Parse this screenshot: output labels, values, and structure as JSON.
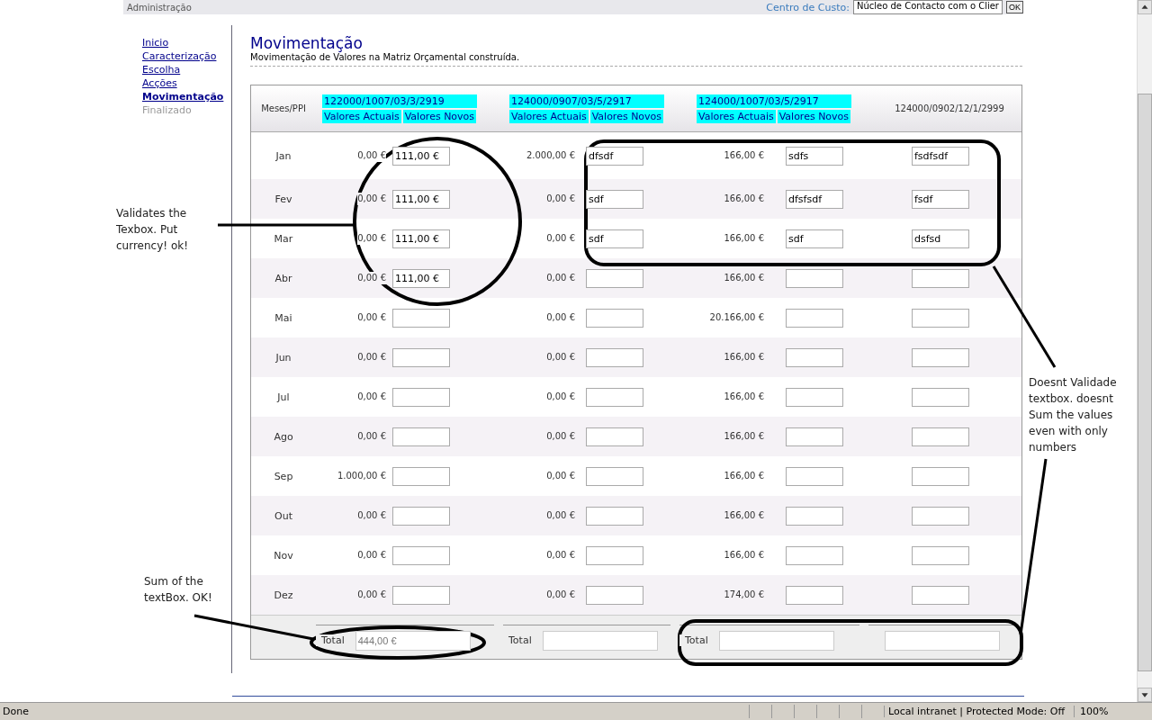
{
  "top_bar": {
    "left_text": "Administração",
    "cost_center_label": "Centro de Custo:",
    "cost_center_value": "Núcleo de Contacto com o Clier",
    "ok_button": "OK"
  },
  "nav": [
    {
      "label": "Inicio",
      "selected": false,
      "disabled": false
    },
    {
      "label": "Caracterização",
      "selected": false,
      "disabled": false
    },
    {
      "label": "Escolha",
      "selected": false,
      "disabled": false
    },
    {
      "label": "Acções",
      "selected": false,
      "disabled": false
    },
    {
      "label": "Movimentação",
      "selected": true,
      "disabled": false
    },
    {
      "label": "Finalizado",
      "selected": false,
      "disabled": true
    }
  ],
  "page": {
    "title": "Movimentação",
    "subtitle": "Movimentação de Valores na Matriz Orçamental construída."
  },
  "table": {
    "corner": "Meses/PPI",
    "groups": [
      {
        "code": "122000/1007/03/3/2919",
        "sub": [
          "Valores Actuais",
          "Valores Novos"
        ]
      },
      {
        "code": "124000/0907/03/5/2917",
        "sub": [
          "Valores Actuais",
          "Valores Novos"
        ]
      },
      {
        "code": "124000/1007/03/5/2917",
        "sub": [
          "Valores Actuais",
          "Valores Novos"
        ]
      },
      {
        "code": "124000/0902/12/1/2999"
      }
    ],
    "rows": [
      {
        "month": "Jan",
        "cells": [
          [
            "0,00 €",
            "111,00 €"
          ],
          [
            "2.000,00 €",
            "dfsdf"
          ],
          [
            "166,00 €",
            "sdfs"
          ],
          [
            null,
            "fsdfsdf"
          ]
        ]
      },
      {
        "month": "Fev",
        "cells": [
          [
            "0,00 €",
            "111,00 €"
          ],
          [
            "0,00 €",
            "sdf"
          ],
          [
            "166,00 €",
            "dfsfsdf"
          ],
          [
            null,
            "fsdf"
          ]
        ]
      },
      {
        "month": "Mar",
        "cells": [
          [
            "0,00 €",
            "111,00 €"
          ],
          [
            "0,00 €",
            "sdf"
          ],
          [
            "166,00 €",
            "sdf"
          ],
          [
            null,
            "dsfsd"
          ]
        ]
      },
      {
        "month": "Abr",
        "cells": [
          [
            "0,00 €",
            "111,00 €"
          ],
          [
            "0,00 €",
            null
          ],
          [
            "166,00 €",
            null
          ],
          [
            null,
            null
          ]
        ]
      },
      {
        "month": "Mai",
        "cells": [
          [
            "0,00 €",
            null
          ],
          [
            "0,00 €",
            null
          ],
          [
            "20.166,00 €",
            null
          ],
          [
            null,
            null
          ]
        ]
      },
      {
        "month": "Jun",
        "cells": [
          [
            "0,00 €",
            null
          ],
          [
            "0,00 €",
            null
          ],
          [
            "166,00 €",
            null
          ],
          [
            null,
            null
          ]
        ]
      },
      {
        "month": "Jul",
        "cells": [
          [
            "0,00 €",
            null
          ],
          [
            "0,00 €",
            null
          ],
          [
            "166,00 €",
            null
          ],
          [
            null,
            null
          ]
        ]
      },
      {
        "month": "Ago",
        "cells": [
          [
            "0,00 €",
            null
          ],
          [
            "0,00 €",
            null
          ],
          [
            "166,00 €",
            null
          ],
          [
            null,
            null
          ]
        ]
      },
      {
        "month": "Sep",
        "cells": [
          [
            "1.000,00 €",
            null
          ],
          [
            "0,00 €",
            null
          ],
          [
            "166,00 €",
            null
          ],
          [
            null,
            null
          ]
        ]
      },
      {
        "month": "Out",
        "cells": [
          [
            "0,00 €",
            null
          ],
          [
            "0,00 €",
            null
          ],
          [
            "166,00 €",
            null
          ],
          [
            null,
            null
          ]
        ]
      },
      {
        "month": "Nov",
        "cells": [
          [
            "0,00 €",
            null
          ],
          [
            "0,00 €",
            null
          ],
          [
            "166,00 €",
            null
          ],
          [
            null,
            null
          ]
        ]
      },
      {
        "month": "Dez",
        "cells": [
          [
            "0,00 €",
            null
          ],
          [
            "0,00 €",
            null
          ],
          [
            "174,00 €",
            null
          ],
          [
            null,
            null
          ]
        ]
      }
    ],
    "totals": [
      {
        "kind": "labeled",
        "label": "Total",
        "value": "444,00 €"
      },
      {
        "kind": "labeled",
        "label": "Total"
      },
      {
        "kind": "labeled",
        "label": "Total"
      },
      {
        "kind": "plain"
      }
    ]
  },
  "annotations": [
    {
      "text": "Validates the Texbox. Put currency! ok!"
    },
    {
      "text": "Doesnt Validade textbox. doesnt Sum the values even with only numbers"
    },
    {
      "text": "Sum of the textBox. OK!"
    }
  ],
  "status_bar": {
    "text": "Done",
    "zone": "Local intranet | Protected Mode: Off",
    "zoom": "100%"
  }
}
